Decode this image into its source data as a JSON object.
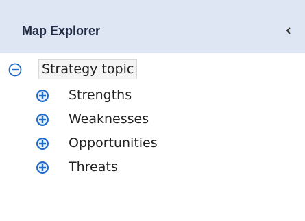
{
  "panel": {
    "title": "Map Explorer",
    "collapse_icon": "chevron-left-icon"
  },
  "tree": {
    "root": {
      "label": "Strategy topic",
      "state_icon": "minus-circle-icon"
    },
    "children": [
      {
        "label": "Strengths",
        "state_icon": "plus-circle-icon"
      },
      {
        "label": "Weaknesses",
        "state_icon": "plus-circle-icon"
      },
      {
        "label": "Opportunities",
        "state_icon": "plus-circle-icon"
      },
      {
        "label": "Threats",
        "state_icon": "plus-circle-icon"
      }
    ]
  },
  "colors": {
    "header_bg": "#dfe6f3",
    "icon_blue": "#1e6bc9",
    "selected_bg": "#f4f4f4"
  }
}
